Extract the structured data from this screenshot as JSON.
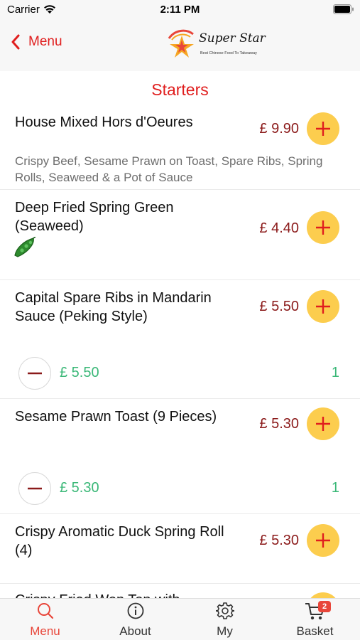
{
  "status_bar": {
    "carrier": "Carrier",
    "time": "2:11 PM"
  },
  "nav": {
    "back_label": "Menu",
    "logo_title": "Super Star",
    "logo_subtitle": "Best Chinese Food To Takeaway"
  },
  "section": {
    "title": "Starters"
  },
  "items": [
    {
      "name": "House Mixed Hors d'Oeures",
      "price": "£ 9.90",
      "description": "Crispy Beef, Sesame Prawn on Toast, Spare Ribs, Spring Rolls, Seaweed & a Pot of Sauce"
    },
    {
      "name": "Deep Fried Spring Green (Seaweed)",
      "price": "£ 4.40",
      "icon": "vegetable-icon"
    },
    {
      "name": "Capital Spare Ribs in Mandarin Sauce (Peking Style)",
      "price": "£ 5.50",
      "basket_price": "£ 5.50",
      "basket_qty": "1"
    },
    {
      "name": "Sesame Prawn Toast (9 Pieces)",
      "price": "£ 5.30",
      "basket_price": "£ 5.30",
      "basket_qty": "1"
    },
    {
      "name": "Crispy Aromatic Duck Spring Roll (4)",
      "price": "£ 5.30"
    },
    {
      "name": "Crispy Fried Won Ton with"
    }
  ],
  "tabs": [
    {
      "label": "Menu",
      "icon": "search-icon",
      "active": true
    },
    {
      "label": "About",
      "icon": "info-icon"
    },
    {
      "label": "My",
      "icon": "gear-icon"
    },
    {
      "label": "Basket",
      "icon": "cart-icon",
      "badge": "2"
    }
  ],
  "colors": {
    "accent_red": "#e01e1e",
    "price": "#8b1a1a",
    "add_button": "#fccd4e",
    "basket_green": "#3bb878",
    "tab_active": "#e8463a"
  }
}
